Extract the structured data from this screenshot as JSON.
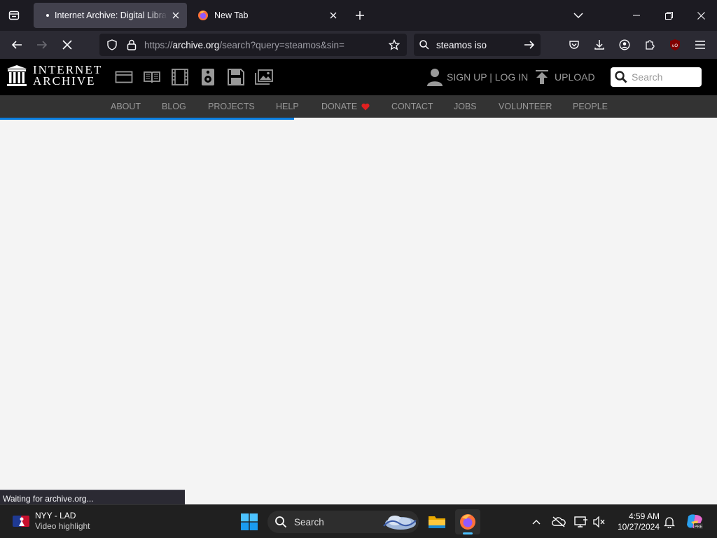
{
  "browser": {
    "tabs": [
      {
        "title": "Internet Archive: Digital Library",
        "active": true
      },
      {
        "title": "New Tab",
        "active": false
      }
    ],
    "url": {
      "scheme": "https://",
      "host": "archive.org",
      "path": "/search?query=steamos&sin="
    },
    "search_query": "steamos iso",
    "status_text": "Waiting for archive.org...",
    "loading_progress": 0.41
  },
  "site": {
    "logo_line1": "INTERNET",
    "logo_line2": "ARCHIVE",
    "account_label": "SIGN UP | LOG IN",
    "upload_label": "UPLOAD",
    "search_placeholder": "Search",
    "nav": [
      {
        "label": "ABOUT"
      },
      {
        "label": "BLOG"
      },
      {
        "label": "PROJECTS"
      },
      {
        "label": "HELP"
      },
      {
        "label": "DONATE"
      },
      {
        "label": "CONTACT"
      },
      {
        "label": "JOBS"
      },
      {
        "label": "VOLUNTEER"
      },
      {
        "label": "PEOPLE"
      }
    ],
    "media_icons": [
      "web-icon",
      "texts-icon",
      "video-icon",
      "audio-icon",
      "software-icon",
      "images-icon"
    ]
  },
  "taskbar": {
    "widget_line1": "NYY - LAD",
    "widget_line2": "Video highlight",
    "search_label": "Search",
    "time": "4:59 AM",
    "date": "10/27/2024"
  },
  "colors": {
    "accent": "#0b7fe0",
    "donate_heart": "#e02020"
  }
}
